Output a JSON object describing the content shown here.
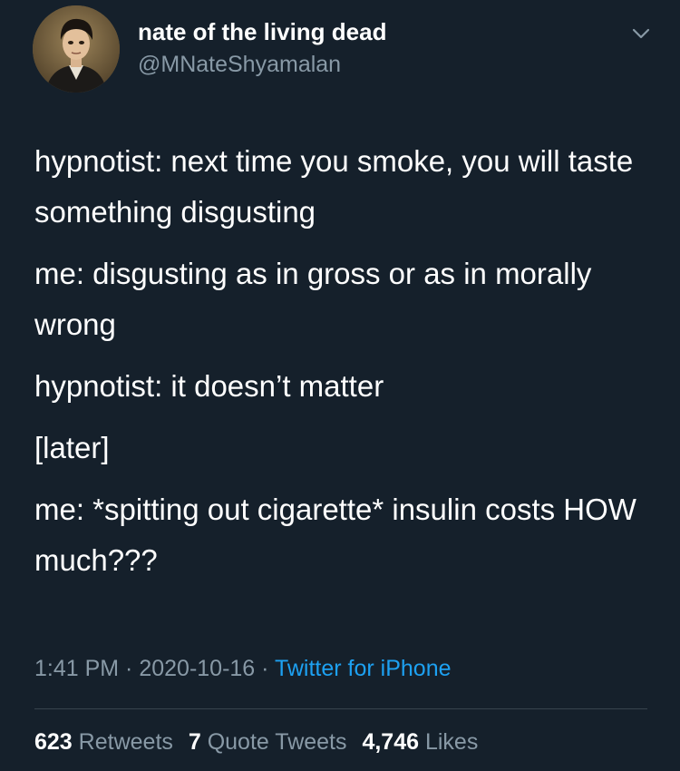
{
  "author": {
    "display_name": "nate of the living dead",
    "handle": "@MNateShyamalan",
    "avatar_icon": "portrait-avatar"
  },
  "menu": {
    "icon": "chevron-down-icon"
  },
  "tweet": {
    "paragraphs": [
      "hypnotist: next time you smoke, you will taste something disgusting",
      "me: disgusting as in gross or as in morally wrong",
      "hypnotist: it doesn’t matter",
      "[later]",
      "me: *spitting out cigarette* insulin costs HOW much???"
    ]
  },
  "meta": {
    "time": "1:41 PM",
    "separator": " · ",
    "date": "2020-10-16",
    "source": "Twitter for iPhone"
  },
  "stats": {
    "retweets_count": "623",
    "retweets_label": "Retweets",
    "quotes_count": "7",
    "quotes_label": "Quote Tweets",
    "likes_count": "4,746",
    "likes_label": "Likes"
  },
  "colors": {
    "background": "#15202b",
    "text": "#ffffff",
    "secondary": "#8899a6",
    "accent": "#1da1f2",
    "divider": "#38444d"
  }
}
